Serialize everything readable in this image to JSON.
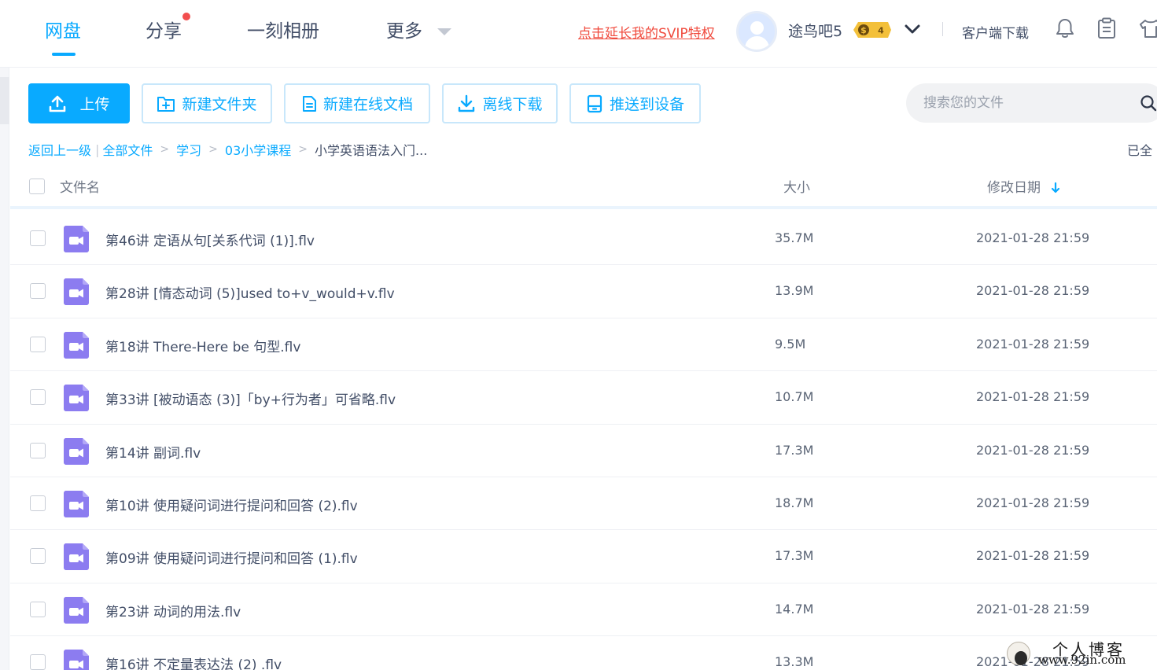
{
  "nav": {
    "tabs": [
      {
        "label": "网盘",
        "active": true
      },
      {
        "label": "分享",
        "has_dot": true
      },
      {
        "label": "一刻相册"
      },
      {
        "label": "更多",
        "has_caret": true
      }
    ],
    "svip_link": "点击延长我的SVIP特权",
    "username": "途鸟吧5",
    "vip_level": "4",
    "vip_symbol": "$",
    "client_download": "客户端下载"
  },
  "toolbar": {
    "upload": "上传",
    "new_folder": "新建文件夹",
    "new_doc": "新建在线文档",
    "offline_download": "离线下载",
    "push_device": "推送到设备"
  },
  "search": {
    "placeholder": "搜索您的文件"
  },
  "breadcrumb": {
    "back": "返回上一级",
    "items": [
      "全部文件",
      "学习",
      "03小学课程"
    ],
    "current": "小学英语语法入门...",
    "separator": ">",
    "bar": "|"
  },
  "loaded_text": "已全",
  "table": {
    "headers": {
      "name": "文件名",
      "size": "大小",
      "date": "修改日期"
    },
    "rows": [
      {
        "name": "第46讲 定语从句[关系代词 (1)].flv",
        "size": "35.7M",
        "date": "2021-01-28 21:59"
      },
      {
        "name": "第28讲 [情态动词 (5)]used to+v_would+v.flv",
        "size": "13.9M",
        "date": "2021-01-28 21:59"
      },
      {
        "name": "第18讲 There-Here be 句型.flv",
        "size": "9.5M",
        "date": "2021-01-28 21:59"
      },
      {
        "name": "第33讲 [被动语态 (3)]「by+行为者」可省略.flv",
        "size": "10.7M",
        "date": "2021-01-28 21:59"
      },
      {
        "name": "第14讲 副词.flv",
        "size": "17.3M",
        "date": "2021-01-28 21:59"
      },
      {
        "name": "第10讲 使用疑问词进行提问和回答 (2).flv",
        "size": "18.7M",
        "date": "2021-01-28 21:59"
      },
      {
        "name": "第09讲 使用疑问词进行提问和回答 (1).flv",
        "size": "17.3M",
        "date": "2021-01-28 21:59"
      },
      {
        "name": "第23讲 动词的用法.flv",
        "size": "14.7M",
        "date": "2021-01-28 21:59"
      },
      {
        "name": "第16讲 不定量表达法 (2) .flv",
        "size": "13.3M",
        "date": "2021-01-28 21:59"
      }
    ]
  },
  "watermark": {
    "title": "个人博客",
    "url": "www.92in.com"
  },
  "colors": {
    "accent": "#09aaff",
    "text": "#424e67",
    "svip_red": "#f04b3e",
    "video_icon": "#8c7cf0",
    "vip_gold": "#f3c03a"
  }
}
